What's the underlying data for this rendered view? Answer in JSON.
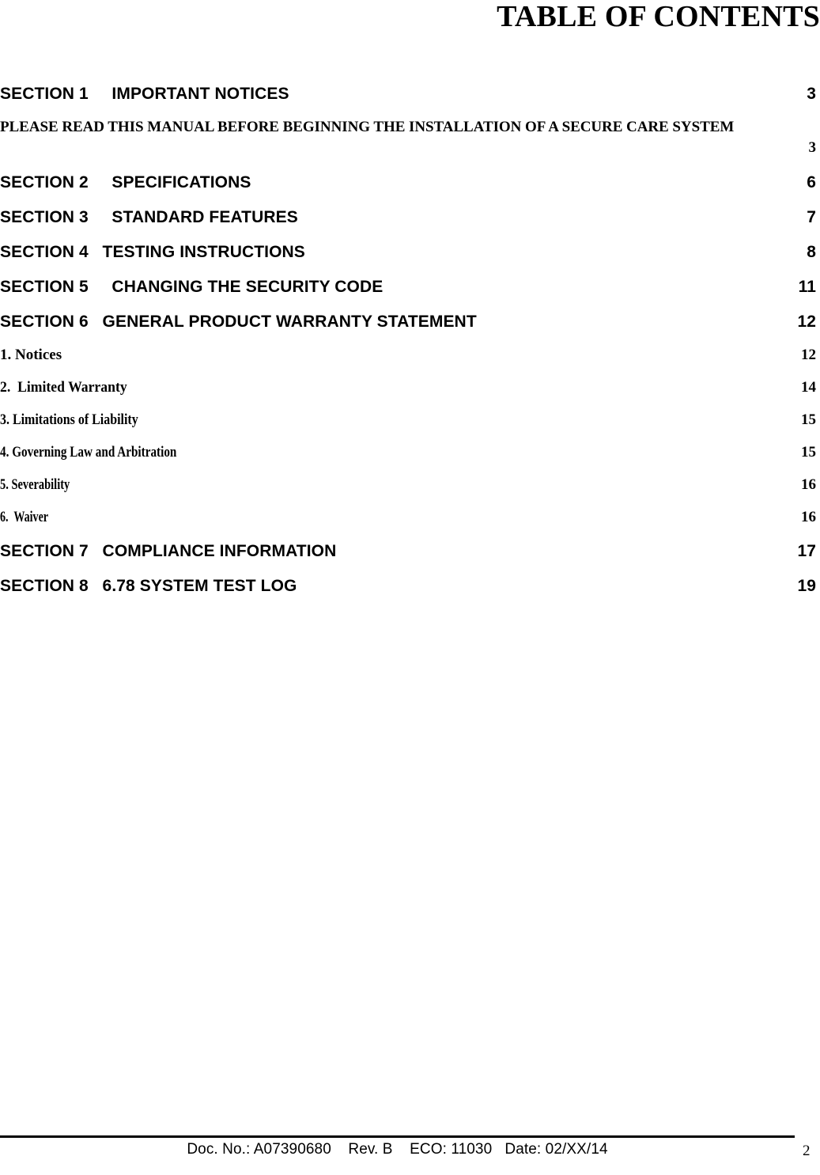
{
  "title": "TABLE OF CONTENTS",
  "toc": {
    "entries": [
      {
        "level": 1,
        "text": "SECTION 1     IMPORTANT NOTICES",
        "page": "3"
      },
      {
        "level": 2,
        "wide": true,
        "text": "PLEASE READ THIS MANUAL BEFORE BEGINNING THE INSTALLATION OF A SECURE CARE SYSTEM",
        "page": "3"
      },
      {
        "level": 1,
        "text": "SECTION 2     SPECIFICATIONS",
        "page": "6"
      },
      {
        "level": 1,
        "text": "SECTION 3     STANDARD FEATURES",
        "page": "7"
      },
      {
        "level": 1,
        "text": "SECTION 4   TESTING INSTRUCTIONS",
        "page": "8"
      },
      {
        "level": 1,
        "text": "SECTION 5     CHANGING THE SECURITY CODE",
        "page": "11"
      },
      {
        "level": 1,
        "text": "SECTION 6   GENERAL PRODUCT WARRANTY STATEMENT",
        "page": "12"
      },
      {
        "level": 2,
        "condense": 0,
        "text": "1. Notices",
        "page": "12"
      },
      {
        "level": 2,
        "condense": 1,
        "text": "2.  Limited Warranty",
        "page": "14"
      },
      {
        "level": 2,
        "condense": 2,
        "text": "3. Limitations of Liability",
        "page": "15"
      },
      {
        "level": 2,
        "condense": 3,
        "text": "4. Governing Law and Arbitration",
        "page": "15"
      },
      {
        "level": 2,
        "condense": 4,
        "text": "5. Severability",
        "page": "16"
      },
      {
        "level": 2,
        "condense": 5,
        "text": "6.  Waiver",
        "page": "16"
      },
      {
        "level": 1,
        "text": "SECTION 7   COMPLIANCE INFORMATION",
        "page": "17"
      },
      {
        "level": 1,
        "text": "SECTION 8   6.78 SYSTEM TEST LOG",
        "page": "19"
      }
    ]
  },
  "footer": {
    "doc_info": "Doc. No.: A07390680    Rev. B    ECO: 11030   Date: 02/XX/14",
    "page_number": "2"
  }
}
